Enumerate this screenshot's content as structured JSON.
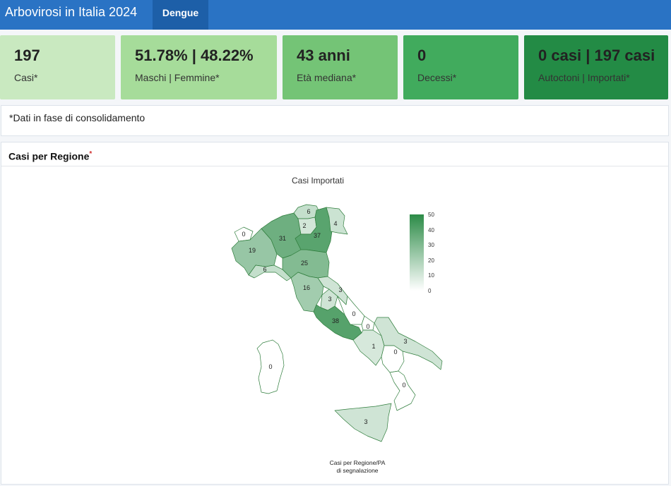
{
  "header": {
    "title": "Arbovirosi in Italia 2024",
    "tab_label": "Dengue"
  },
  "value_boxes": [
    {
      "value": "197",
      "label": "Casi*",
      "color": "#c9e9c0"
    },
    {
      "value": "51.78% | 48.22%",
      "label": "Maschi | Femmine*",
      "color": "#a6dc9a"
    },
    {
      "value": "43 anni",
      "label": "Età mediana*",
      "color": "#74c476"
    },
    {
      "value": "0",
      "label": "Decessi*",
      "color": "#41ab5d"
    },
    {
      "value": "0 casi | 197 casi",
      "label": "Autoctoni | Importati*",
      "color": "#238b45"
    }
  ],
  "note": "*Dati in fase di consolidamento",
  "map_panel": {
    "title": "Casi per Regione",
    "title_mark": "*",
    "map_title": "Casi Importati",
    "caption_line1": "Casi per Regione/PA",
    "caption_line2": "di segnalazione",
    "legend_ticks": [
      "50",
      "40",
      "30",
      "20",
      "10",
      "0"
    ],
    "legend_range": [
      0,
      50
    ],
    "color_low": "#ffffff",
    "color_high": "#2c8b47",
    "regions": [
      {
        "name": "Valle d'Aosta",
        "value": "0"
      },
      {
        "name": "Piemonte",
        "value": "19"
      },
      {
        "name": "Liguria",
        "value": "6"
      },
      {
        "name": "Lombardia",
        "value": "31"
      },
      {
        "name": "Trentino-Alto Adige (Bolzano)",
        "value": "6"
      },
      {
        "name": "Trentino-Alto Adige (Trento)",
        "value": "2"
      },
      {
        "name": "Veneto",
        "value": "37"
      },
      {
        "name": "Friuli-Venezia Giulia",
        "value": "4"
      },
      {
        "name": "Emilia-Romagna",
        "value": "25"
      },
      {
        "name": "Toscana",
        "value": "16"
      },
      {
        "name": "Umbria",
        "value": "3"
      },
      {
        "name": "Marche",
        "value": "3"
      },
      {
        "name": "Lazio",
        "value": "38"
      },
      {
        "name": "Abruzzo",
        "value": "0"
      },
      {
        "name": "Molise",
        "value": "0"
      },
      {
        "name": "Campania",
        "value": "1"
      },
      {
        "name": "Puglia",
        "value": "3"
      },
      {
        "name": "Basilicata",
        "value": "0"
      },
      {
        "name": "Calabria",
        "value": "0"
      },
      {
        "name": "Sicilia",
        "value": "3"
      },
      {
        "name": "Sardegna",
        "value": "0"
      }
    ]
  }
}
